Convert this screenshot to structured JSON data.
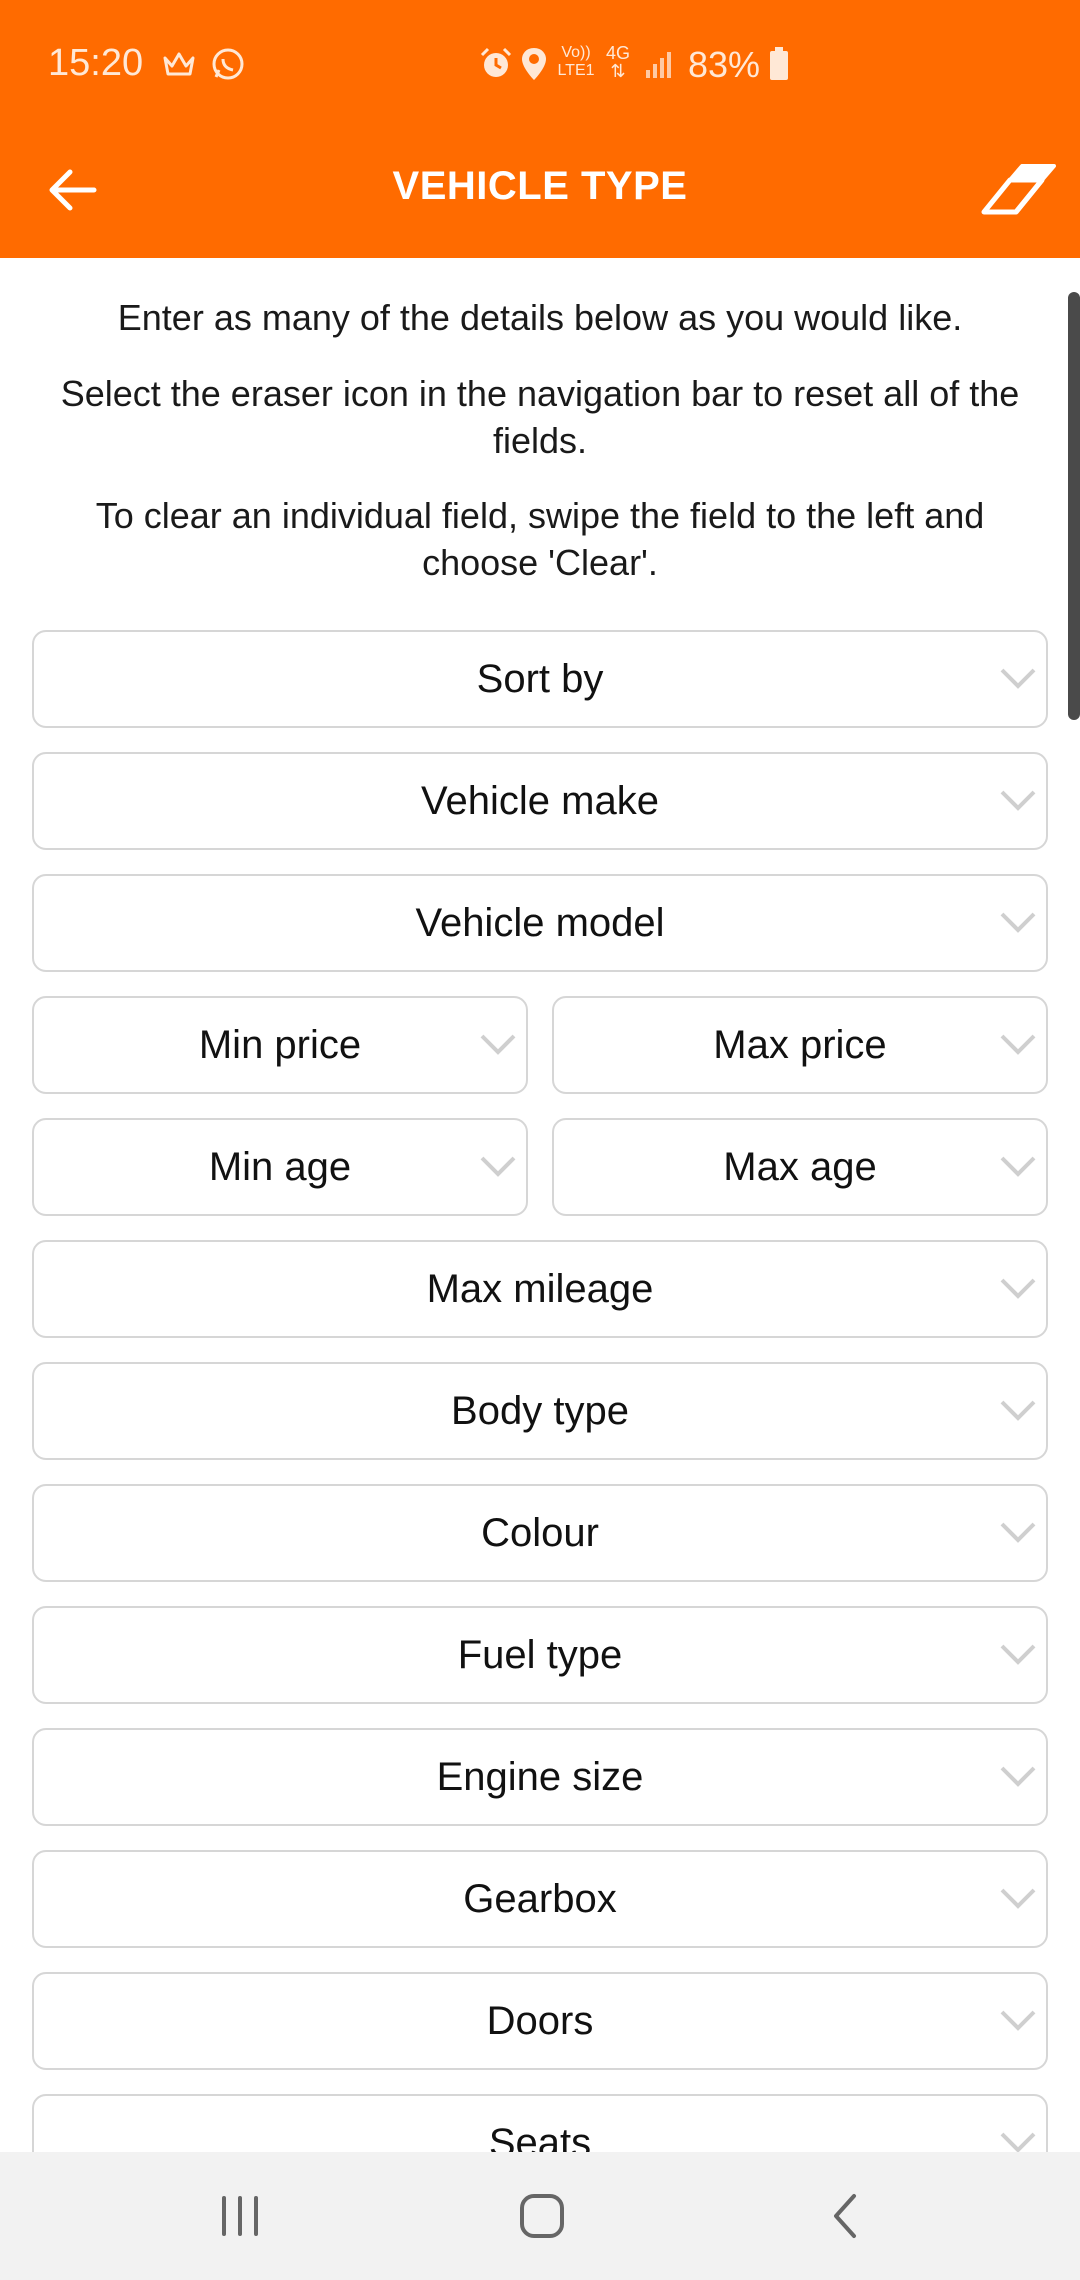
{
  "status_bar": {
    "time": "15:20",
    "network_label_top": "Vo))",
    "network_label_bottom": "LTE1",
    "network_type": "4G",
    "battery": "83%"
  },
  "app_bar": {
    "title": "VEHICLE TYPE"
  },
  "intro": {
    "line1": "Enter as many of the details below as you would like.",
    "line2": "Select the eraser icon in the navigation bar to reset all of the fields.",
    "line3": "To clear an individual field, swipe the field to the left and choose 'Clear'."
  },
  "fields": {
    "sort_by": "Sort by",
    "vehicle_make": "Vehicle make",
    "vehicle_model": "Vehicle model",
    "min_price": "Min price",
    "max_price": "Max price",
    "min_age": "Min age",
    "max_age": "Max age",
    "max_mileage": "Max mileage",
    "body_type": "Body type",
    "colour": "Colour",
    "fuel_type": "Fuel type",
    "engine_size": "Engine size",
    "gearbox": "Gearbox",
    "doors": "Doors",
    "seats": "Seats"
  },
  "colors": {
    "brand": "#ff6b00",
    "field_border": "#d6d6d6",
    "nav_bar": "#f2f2f2"
  },
  "icons": {
    "status": [
      "crown-icon",
      "whatsapp-icon",
      "alarm-icon",
      "location-icon",
      "signal-icon",
      "battery-icon"
    ],
    "app_bar": [
      "back-arrow-icon",
      "eraser-icon"
    ],
    "nav": [
      "recent-apps-icon",
      "home-icon",
      "back-icon"
    ]
  }
}
